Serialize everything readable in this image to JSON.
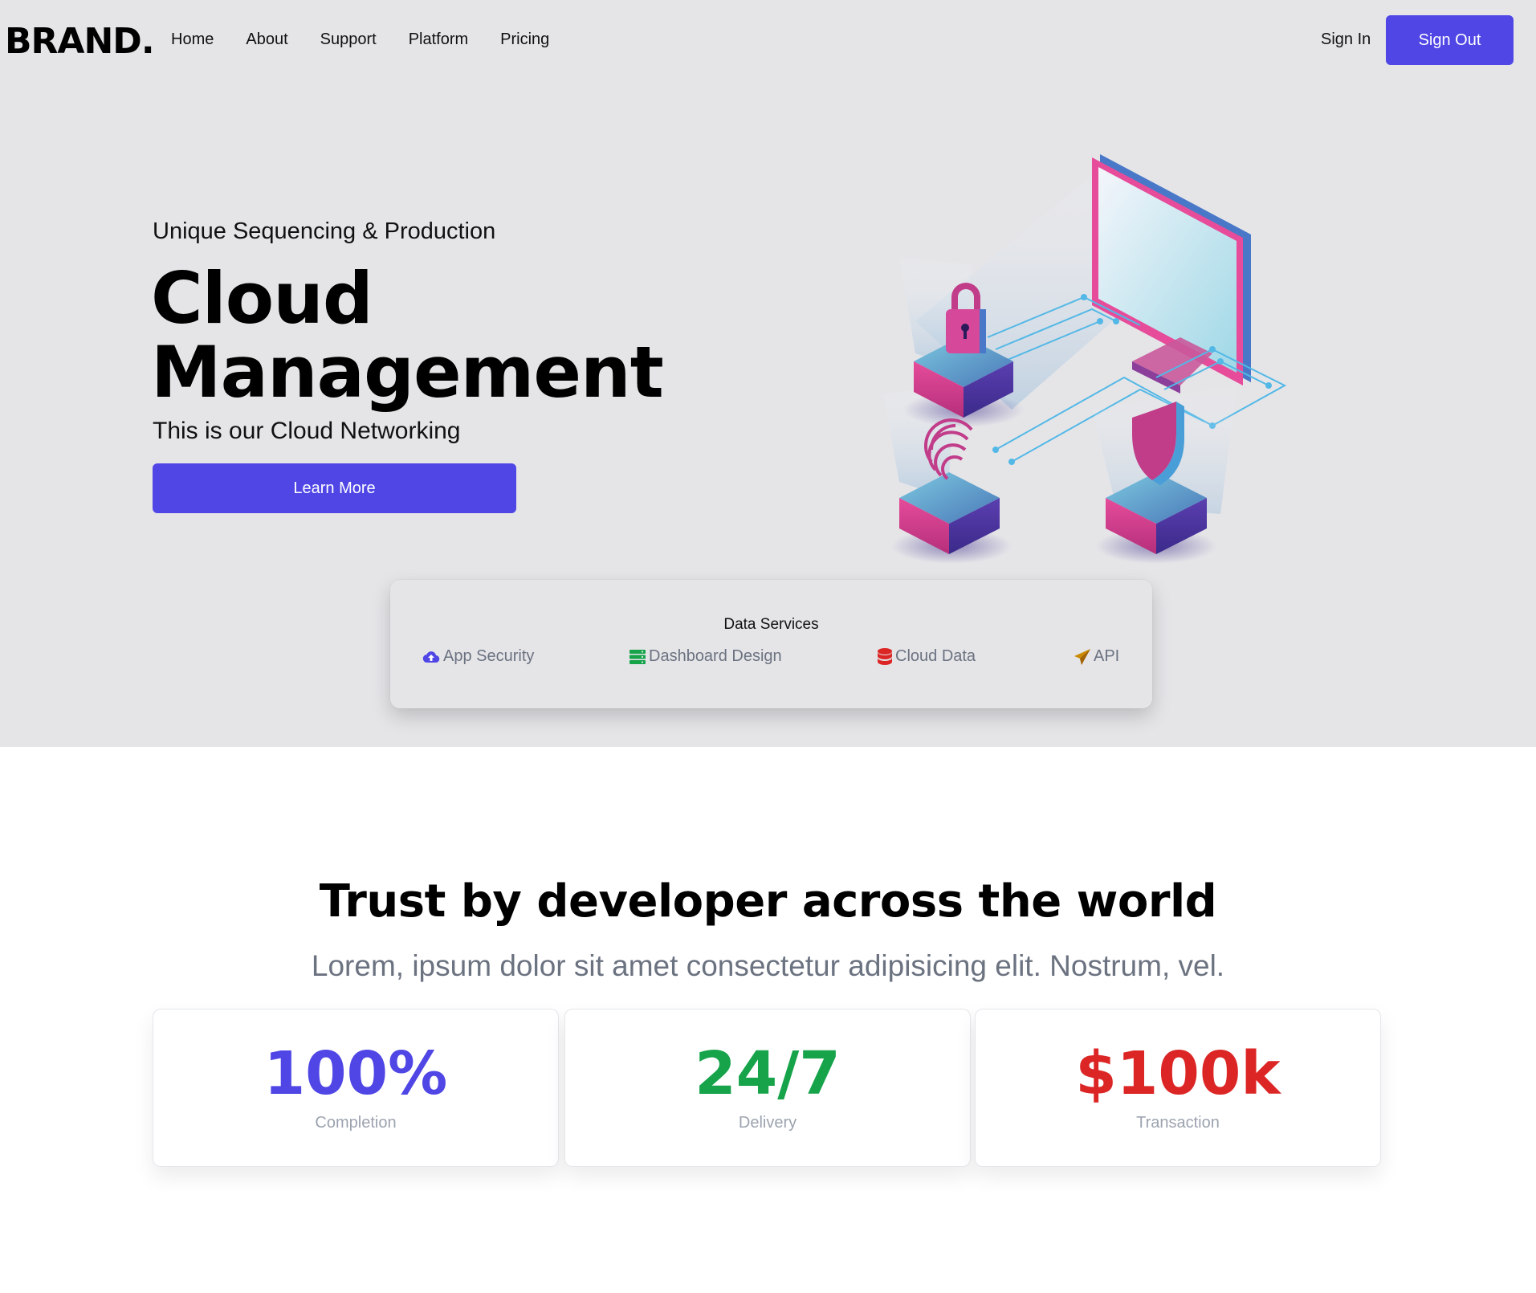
{
  "nav": {
    "brand": "BRAND.",
    "links": [
      "Home",
      "About",
      "Support",
      "Platform",
      "Pricing"
    ],
    "sign_in": "Sign In",
    "sign_out": "Sign Out"
  },
  "hero": {
    "eyebrow": "Unique Sequencing & Production",
    "title_line1": "Cloud",
    "title_line2": "Management",
    "subtitle": "This is our Cloud Networking",
    "cta": "Learn More"
  },
  "services": {
    "title": "Data Services",
    "items": [
      {
        "label": "App Security",
        "icon": "cloud-upload-icon",
        "color": "#4f46e5"
      },
      {
        "label": "Dashboard Design",
        "icon": "server-icon",
        "color": "#16a34a"
      },
      {
        "label": "Cloud Data",
        "icon": "database-icon",
        "color": "#dc2626"
      },
      {
        "label": "API",
        "icon": "paper-plane-icon",
        "color": "#ca8a04"
      }
    ]
  },
  "trust": {
    "title": "Trust by developer across the world",
    "subtitle": "Lorem, ipsum dolor sit amet consectetur adipisicing elit. Nostrum, vel.",
    "stats": [
      {
        "value": "100%",
        "label": "Completion",
        "color": "#4f46e5"
      },
      {
        "value": "24/7",
        "label": "Delivery",
        "color": "#16a34a"
      },
      {
        "value": "$100k",
        "label": "Transaction",
        "color": "#dc2626"
      }
    ]
  },
  "colors": {
    "accent": "#4f46e5",
    "hero_bg": "#e5e5e8"
  }
}
